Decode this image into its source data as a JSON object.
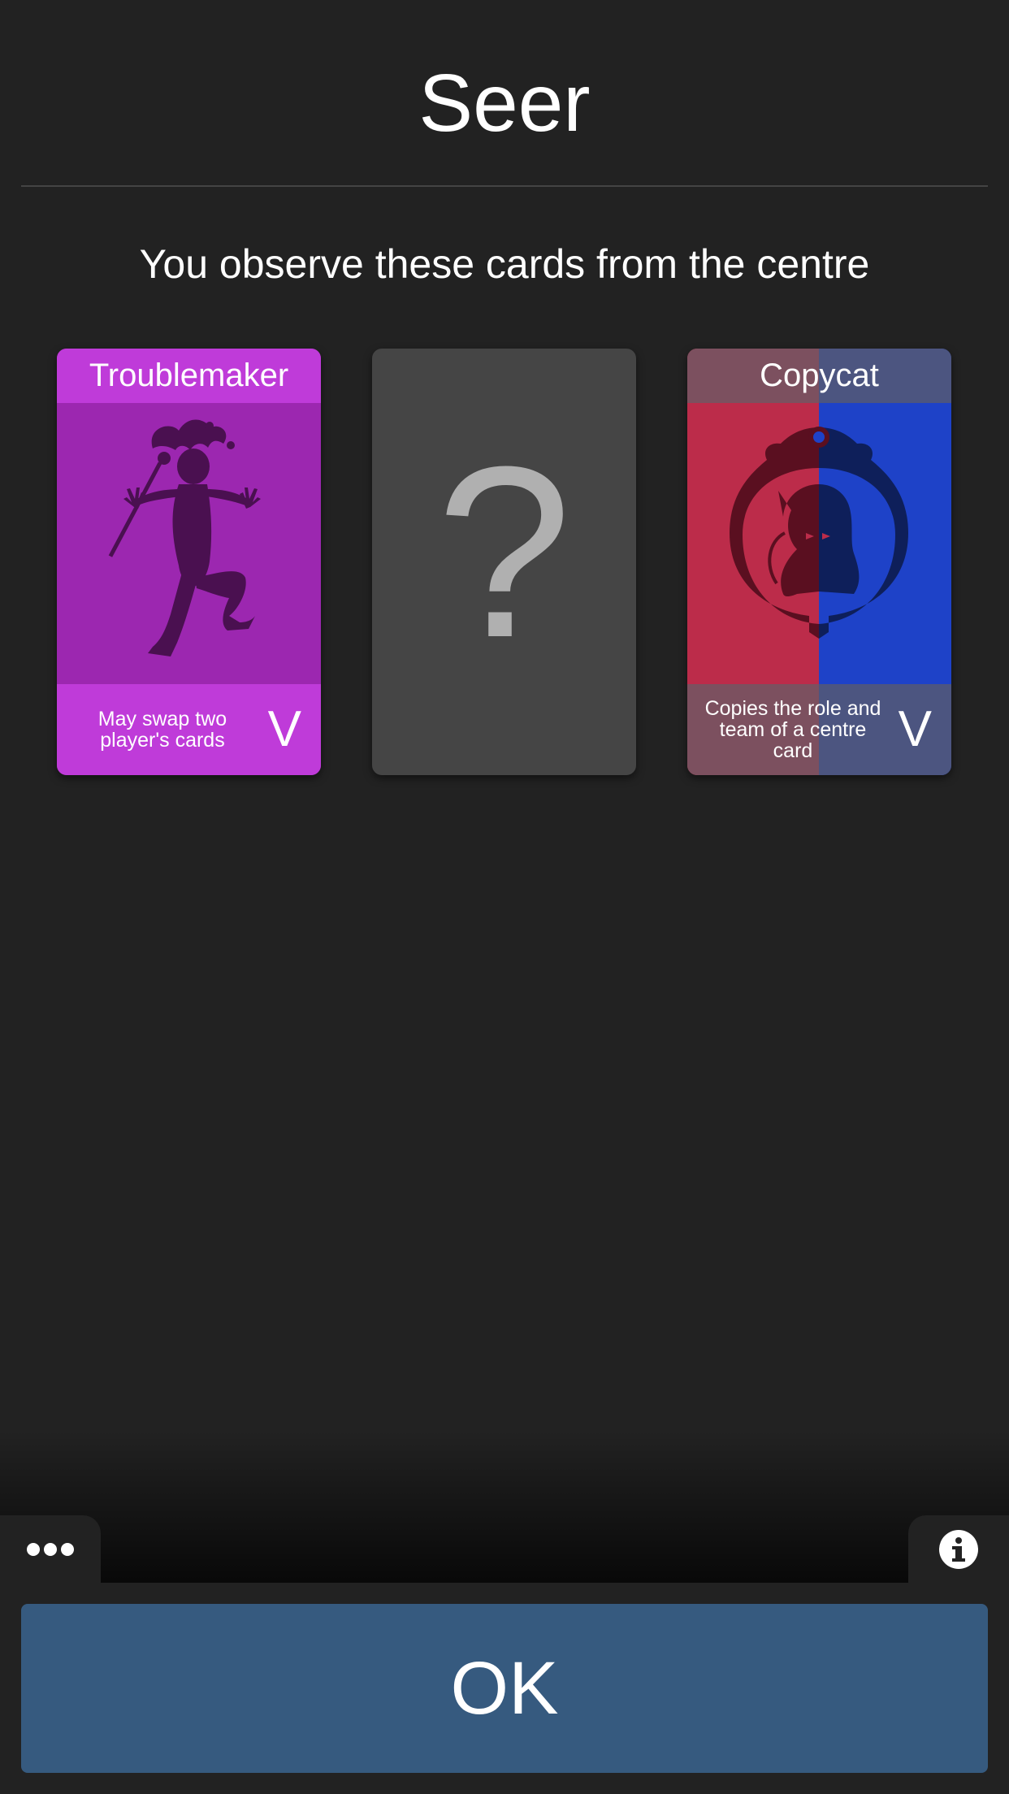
{
  "header": {
    "title": "Seer",
    "subtitle": "You observe these cards from the centre"
  },
  "cards": [
    {
      "name": "Troublemaker",
      "description": "May swap two player's cards",
      "badge": "V",
      "icon": "jester-silhouette-icon",
      "color": "#bf3bd9"
    },
    {
      "name": "",
      "symbol": "?",
      "icon": "question-mark-icon",
      "state": "hidden"
    },
    {
      "name": "Copycat",
      "description": "Copies the role and team of a centre card",
      "badge": "V",
      "icon": "cat-mirror-icon",
      "colors": [
        "#bc2c4a",
        "#1e42c8"
      ]
    }
  ],
  "bottom": {
    "menu_icon": "ellipsis-icon",
    "info_icon": "info-icon",
    "ok_label": "OK"
  },
  "colors": {
    "background": "#222222",
    "button": "#365a7f"
  }
}
